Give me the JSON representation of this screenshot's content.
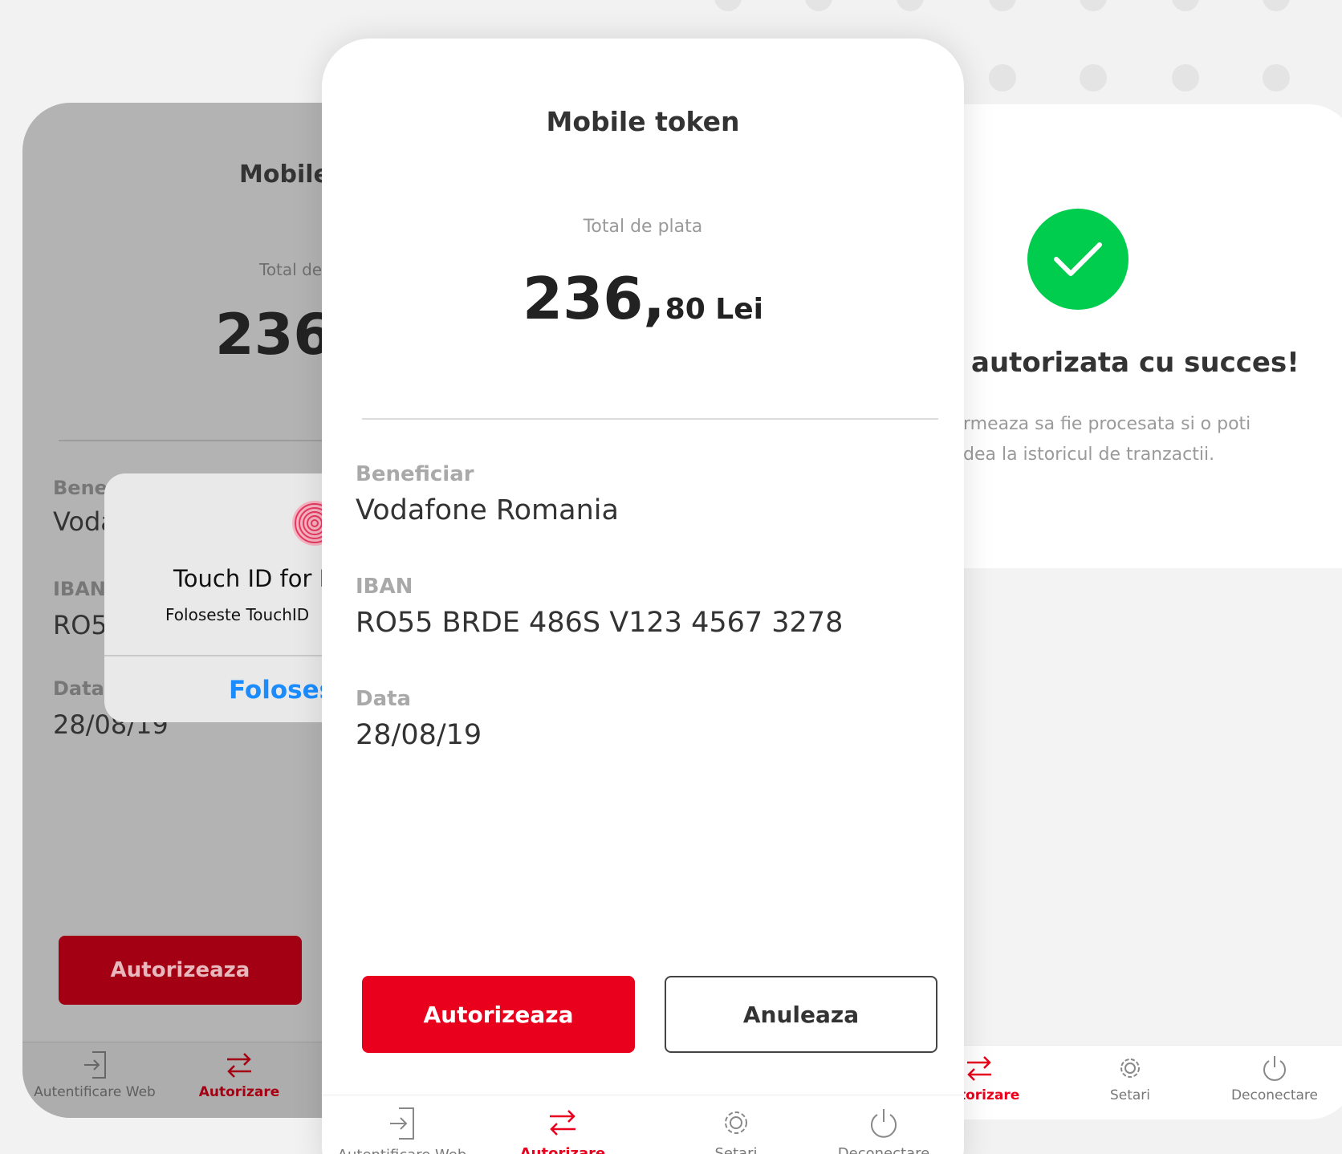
{
  "colors": {
    "brand_red": "#e8001c",
    "dark_red": "#a30014",
    "success_green": "#00cc4d",
    "ios_blue": "#1a8cff"
  },
  "left_screen": {
    "title": "Mobile",
    "total_label": "Total de",
    "amount": "236,",
    "beneficiar_label": "Benef",
    "beneficiar_value": "Voda",
    "iban_label": "IBAN",
    "iban_value": "RO5",
    "data_label": "Data",
    "data_value": "28/08/19",
    "authorize_button": "Autorizeaza",
    "nav": [
      {
        "label": "Autentificare Web",
        "icon": "login-icon"
      },
      {
        "label": "Autorizare",
        "icon": "transfer-arrows-icon"
      }
    ],
    "touch_id_alert": {
      "icon": "fingerprint-icon",
      "title": "Touch ID for M",
      "message": "Foloseste TouchID",
      "action": "Folosest"
    }
  },
  "middle_screen": {
    "title": "Mobile token",
    "total_label": "Total de plata",
    "amount_int": "236,",
    "amount_dec": "80 Lei",
    "beneficiar_label": "Beneficiar",
    "beneficiar_value": "Vodafone Romania",
    "iban_label": "IBAN",
    "iban_value": "RO55 BRDE 486S V123 4567 3278",
    "data_label": "Data",
    "data_value": "28/08/19",
    "authorize_button": "Autorizeaza",
    "cancel_button": "Anuleaza",
    "nav": [
      {
        "label": "Autentificare Web",
        "icon": "login-icon"
      },
      {
        "label": "Autorizare",
        "icon": "transfer-arrows-icon"
      },
      {
        "label": "Setari",
        "icon": "gear-icon"
      },
      {
        "label": "Deconectare",
        "icon": "power-icon"
      }
    ]
  },
  "right_screen": {
    "heading": "autorizata cu succes!",
    "description_line1": "rmeaza sa fie procesata si o poti",
    "description_line2": "dea la istoricul de tranzactii.",
    "status_icon": "checkmark-icon",
    "nav": [
      {
        "label": "Autorizare",
        "icon": "transfer-arrows-icon"
      },
      {
        "label": "Setari",
        "icon": "gear-icon"
      },
      {
        "label": "Deconectare",
        "icon": "power-icon"
      }
    ]
  }
}
